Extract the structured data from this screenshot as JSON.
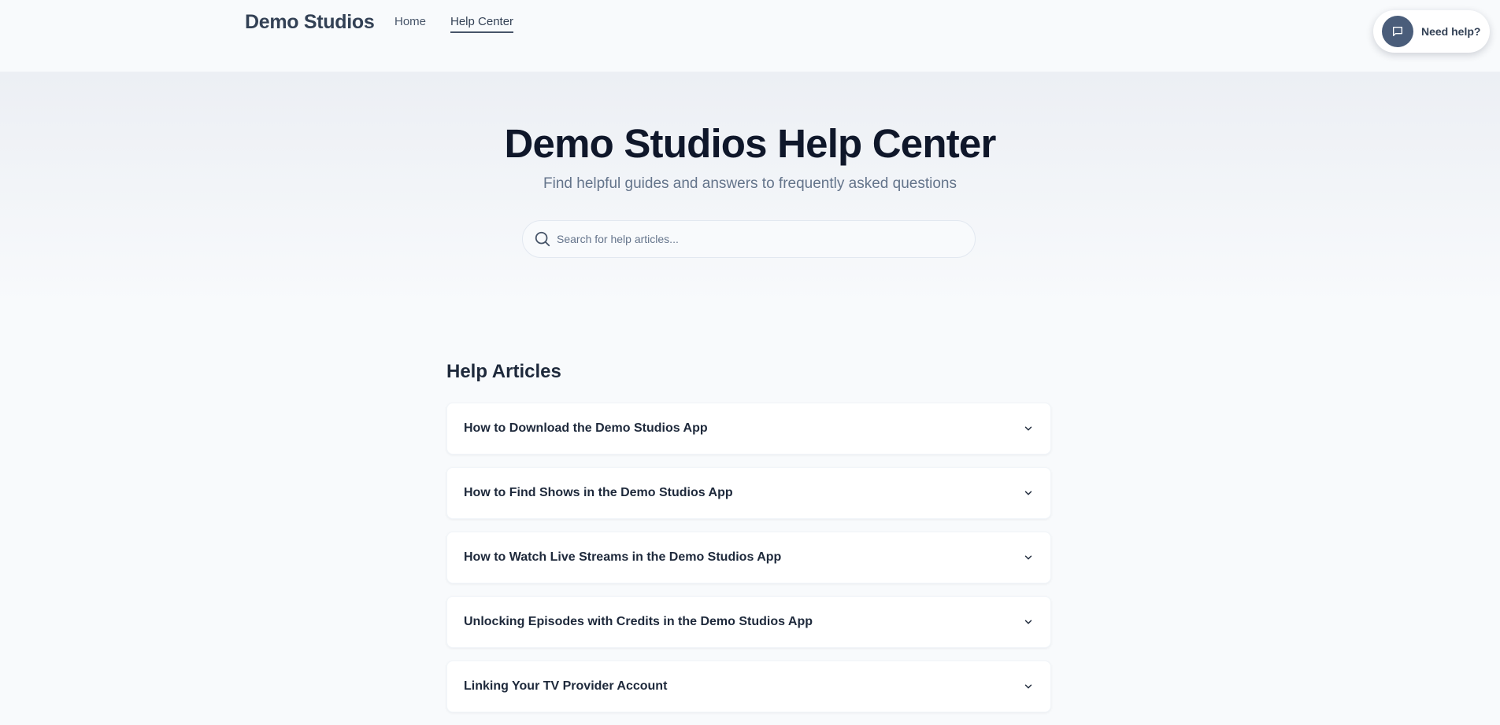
{
  "nav": {
    "brand": "Demo Studios",
    "links": [
      "Home",
      "Help Center"
    ],
    "active": "Help Center"
  },
  "chat_widget": {
    "label": "Need help?",
    "icon": "message-square-icon"
  },
  "hero": {
    "title": "Demo Studios Help Center",
    "subtitle": "Find helpful guides and answers to frequently asked questions",
    "search_placeholder": "Search for help articles..."
  },
  "articles": {
    "heading": "Help Articles",
    "items": [
      "How to Download the Demo Studios App",
      "How to Find Shows in the Demo Studios App",
      "How to Watch Live Streams in the Demo Studios App",
      "Unlocking Episodes with Credits in the Demo Studios App",
      "Linking Your TV Provider Account"
    ]
  },
  "colors": {
    "background": "#f8fafc",
    "accent": "#4a5d7a",
    "text_dark": "#0f172a",
    "text_muted": "#64748b"
  }
}
